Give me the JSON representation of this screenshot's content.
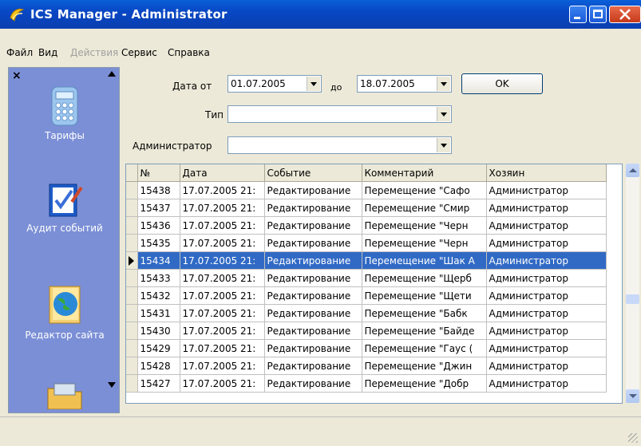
{
  "window": {
    "title": "ICS Manager - Administrator"
  },
  "menu": {
    "file": "Файл",
    "view": "Вид",
    "actions": "Действия",
    "service": "Сервис",
    "help": "Справка"
  },
  "sidebar": {
    "items": [
      {
        "label": "Тарифы",
        "icon": "calculator-icon"
      },
      {
        "label": "Аудит событий",
        "icon": "checklist-icon"
      },
      {
        "label": "Редактор сайта",
        "icon": "globe-book-icon"
      },
      {
        "label": "",
        "icon": "folder-tools-icon"
      }
    ]
  },
  "filters": {
    "date_from_label": "Дата от",
    "date_from": "01.07.2005",
    "date_to_label": "до",
    "date_to": "18.07.2005",
    "ok_label": "OK",
    "type_label": "Тип",
    "type_value": "",
    "admin_label": "Администратор",
    "admin_value": ""
  },
  "grid": {
    "columns": [
      "№",
      "Дата",
      "Событие",
      "Комментарий",
      "Хозяин"
    ],
    "selected_index": 4,
    "rows": [
      [
        "15438",
        "17.07.2005 21:",
        "Редактирование",
        "Перемещение \"Сафо",
        "Администратор"
      ],
      [
        "15437",
        "17.07.2005 21:",
        "Редактирование",
        "Перемещение \"Смир",
        "Администратор"
      ],
      [
        "15436",
        "17.07.2005 21:",
        "Редактирование",
        "Перемещение \"Черн",
        "Администратор"
      ],
      [
        "15435",
        "17.07.2005 21:",
        "Редактирование",
        "Перемещение \"Черн",
        "Администратор"
      ],
      [
        "15434",
        "17.07.2005 21:",
        "Редактирование",
        "Перемещение \"Шак А",
        "Администратор"
      ],
      [
        "15433",
        "17.07.2005 21:",
        "Редактирование",
        "Перемещение \"Щерб",
        "Администратор"
      ],
      [
        "15432",
        "17.07.2005 21:",
        "Редактирование",
        "Перемещение \"Щети",
        "Администратор"
      ],
      [
        "15431",
        "17.07.2005 21:",
        "Редактирование",
        "Перемещение \"Бабк",
        "Администратор"
      ],
      [
        "15430",
        "17.07.2005 21:",
        "Редактирование",
        "Перемещение \"Байде",
        "Администратор"
      ],
      [
        "15429",
        "17.07.2005 21:",
        "Редактирование",
        "Перемещение \"Гаус (",
        "Администратор"
      ],
      [
        "15428",
        "17.07.2005 21:",
        "Редактирование",
        "Перемещение \"Джин",
        "Администратор"
      ],
      [
        "15427",
        "17.07.2005 21:",
        "Редактирование",
        "Перемещение \"Добр",
        "Администратор"
      ]
    ]
  }
}
